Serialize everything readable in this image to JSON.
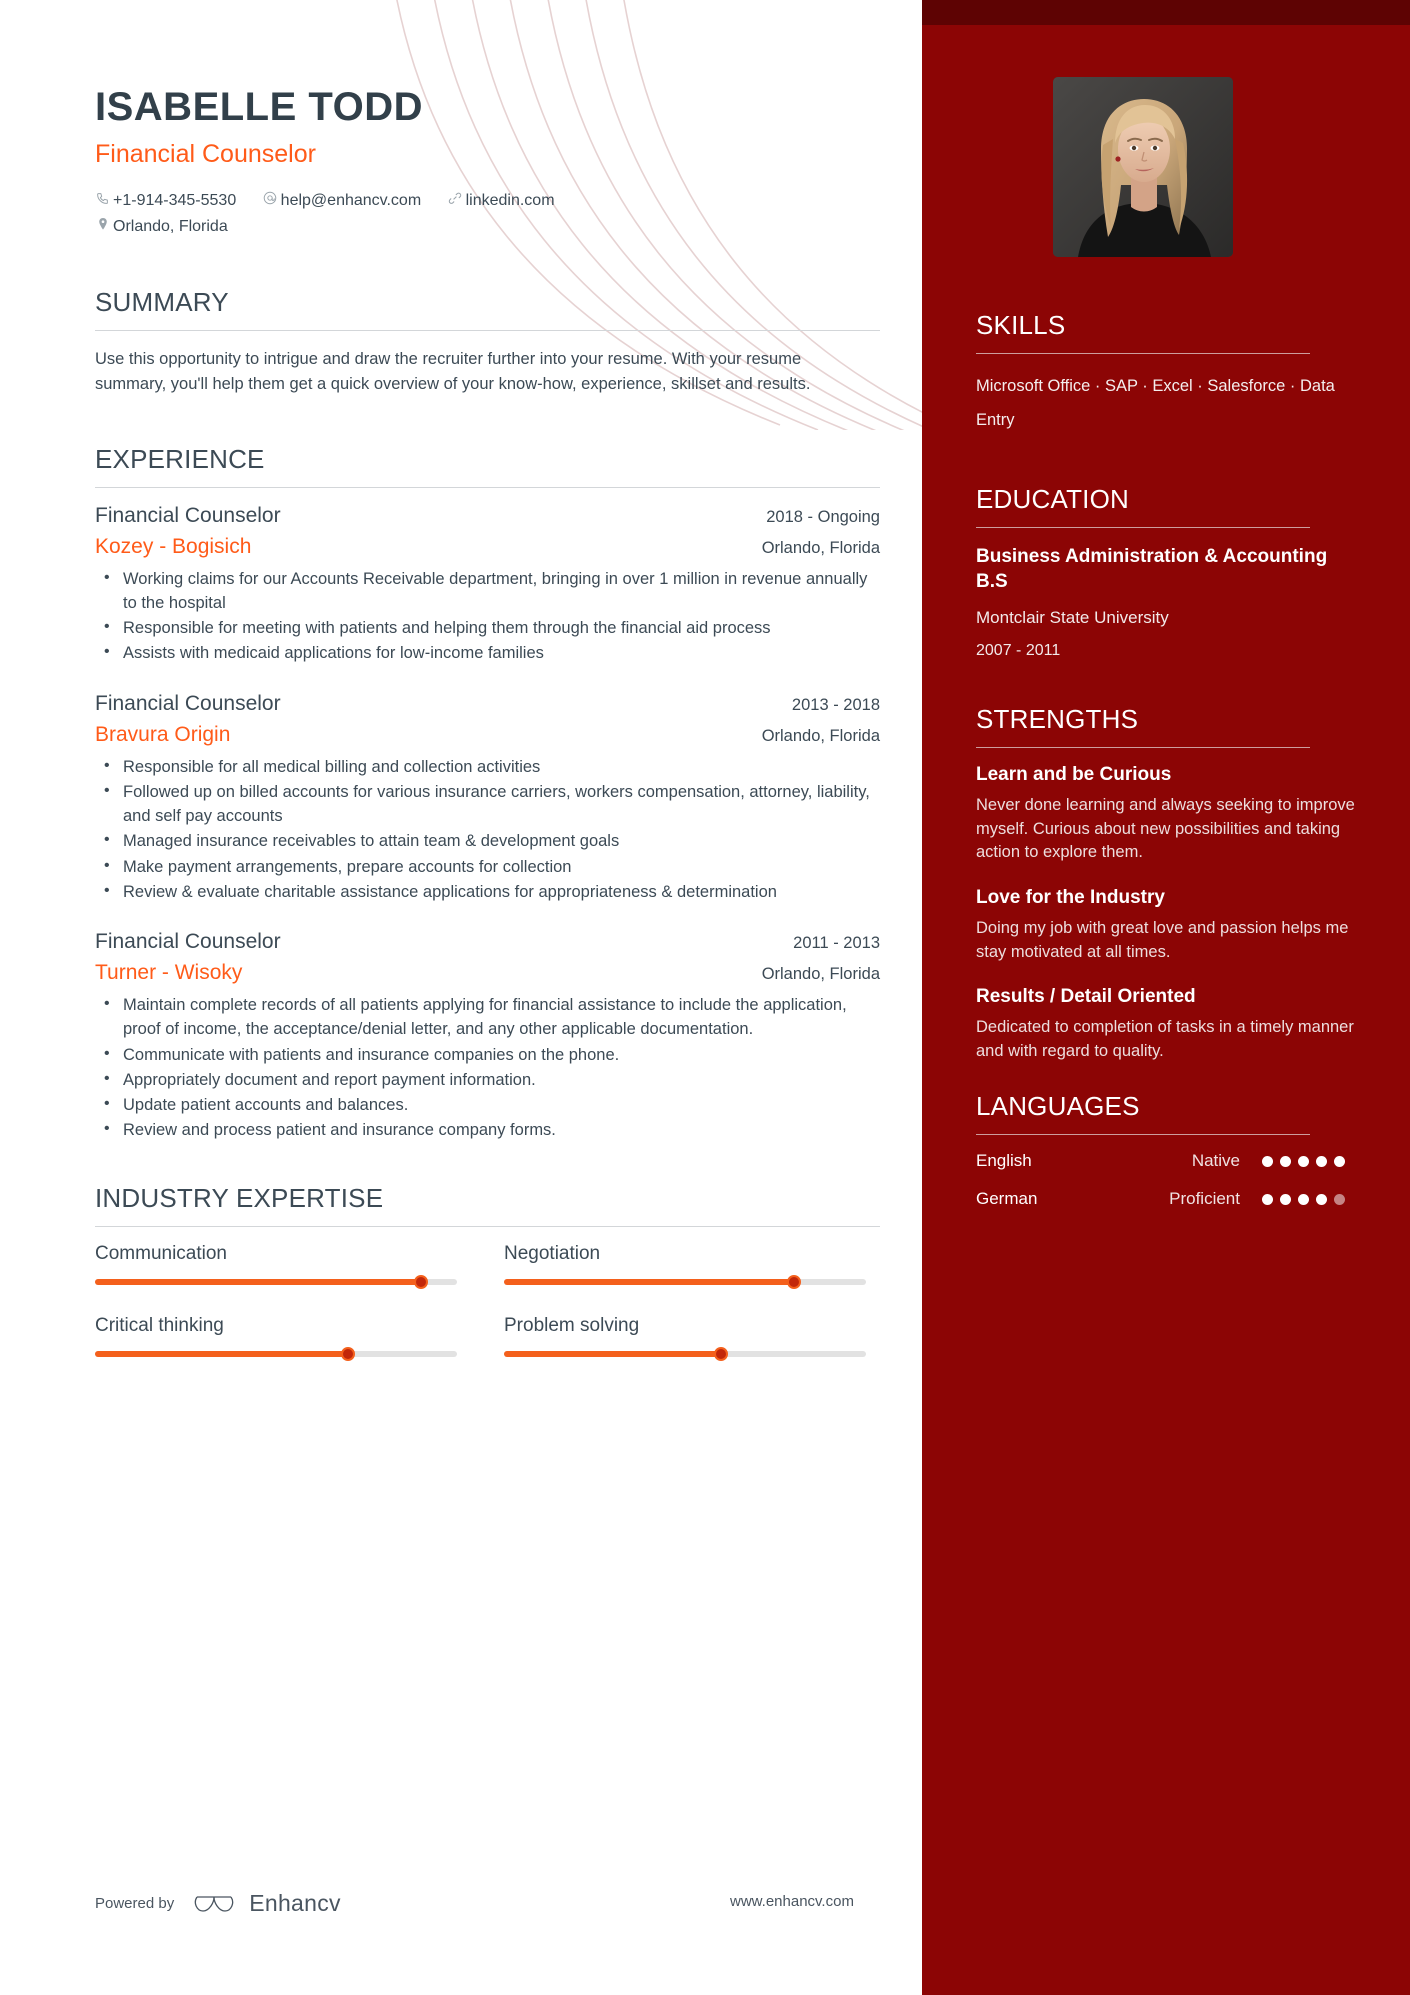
{
  "colors": {
    "accent_orange": "#ff5b19",
    "sidebar_red": "#8c0505",
    "sidebar_top_strip": "#5e0303",
    "text_dark": "#3c4a55",
    "rule_gray": "#d3d6d9"
  },
  "header": {
    "name": "ISABELLE TODD",
    "job_title": "Financial Counselor",
    "contacts": [
      {
        "icon": "phone-icon",
        "glyph": "✆",
        "text": "+1-914-345-5530"
      },
      {
        "icon": "email-icon",
        "glyph": "@",
        "text": "help@enhancv.com"
      },
      {
        "icon": "link-icon",
        "glyph": "⚭",
        "text": "linkedin.com"
      },
      {
        "icon": "location-icon",
        "glyph": "▾",
        "text": "Orlando, Florida"
      }
    ]
  },
  "summary": {
    "heading": "SUMMARY",
    "text": "Use this opportunity to intrigue and draw the recruiter further into your resume. With your resume summary, you'll help them get a quick overview of your know-how, experience, skillset and results."
  },
  "experience": {
    "heading": "EXPERIENCE",
    "jobs": [
      {
        "position": "Financial Counselor",
        "dates": "2018 - Ongoing",
        "company": "Kozey - Bogisich",
        "location": "Orlando, Florida",
        "bullets": [
          "Working claims for our Accounts Receivable department, bringing in over 1 million in revenue annually to the hospital",
          "Responsible for meeting with patients and helping them through the financial aid process",
          "Assists with medicaid applications for low-income families"
        ]
      },
      {
        "position": "Financial Counselor",
        "dates": "2013 - 2018",
        "company": "Bravura Origin",
        "location": "Orlando, Florida",
        "bullets": [
          "Responsible for all medical billing and collection activities",
          "Followed up on billed accounts for various insurance carriers, workers compensation, attorney, liability, and self pay accounts",
          "Managed insurance receivables to attain team & development goals",
          "Make payment arrangements, prepare accounts for collection",
          "Review & evaluate charitable assistance applications for appropriateness & determination"
        ]
      },
      {
        "position": "Financial Counselor",
        "dates": "2011 - 2013",
        "company": "Turner - Wisoky",
        "location": "Orlando, Florida",
        "bullets": [
          "Maintain complete records of all patients applying for financial assistance to include the application, proof of income, the acceptance/denial letter, and any other applicable documentation.",
          "Communicate with patients and insurance companies on the phone.",
          "Appropriately document and report payment information.",
          "Update patient accounts and balances.",
          "Review and process patient and insurance company forms."
        ]
      }
    ]
  },
  "industry_expertise": {
    "heading": "INDUSTRY EXPERTISE",
    "items": [
      {
        "label": "Communication",
        "value": 90
      },
      {
        "label": "Negotiation",
        "value": 80
      },
      {
        "label": "Critical thinking",
        "value": 70
      },
      {
        "label": "Problem solving",
        "value": 60
      }
    ]
  },
  "skills": {
    "heading": "SKILLS",
    "text": "Microsoft Office · SAP · Excel · Salesforce · Data Entry"
  },
  "education": {
    "heading": "EDUCATION",
    "degree": "Business Administration & Accounting B.S",
    "school": "Montclair State University",
    "dates": "2007 - 2011"
  },
  "strengths": {
    "heading": "STRENGTHS",
    "items": [
      {
        "title": "Learn and be Curious",
        "desc": "Never done learning and always seeking to improve myself. Curious about new possibilities and taking action to explore them."
      },
      {
        "title": "Love for the Industry",
        "desc": "Doing my job with great love and passion helps me stay motivated at all times."
      },
      {
        "title": "Results / Detail Oriented",
        "desc": "Dedicated to completion of tasks in a timely manner and with regard to quality."
      }
    ]
  },
  "languages": {
    "heading": "LANGUAGES",
    "items": [
      {
        "name": "English",
        "level": "Native",
        "filled": 5,
        "total": 5
      },
      {
        "name": "German",
        "level": "Proficient",
        "filled": 4,
        "total": 5
      }
    ]
  },
  "footer": {
    "powered_by": "Powered by",
    "brand": "Enhancv",
    "url": "www.enhancv.com"
  }
}
